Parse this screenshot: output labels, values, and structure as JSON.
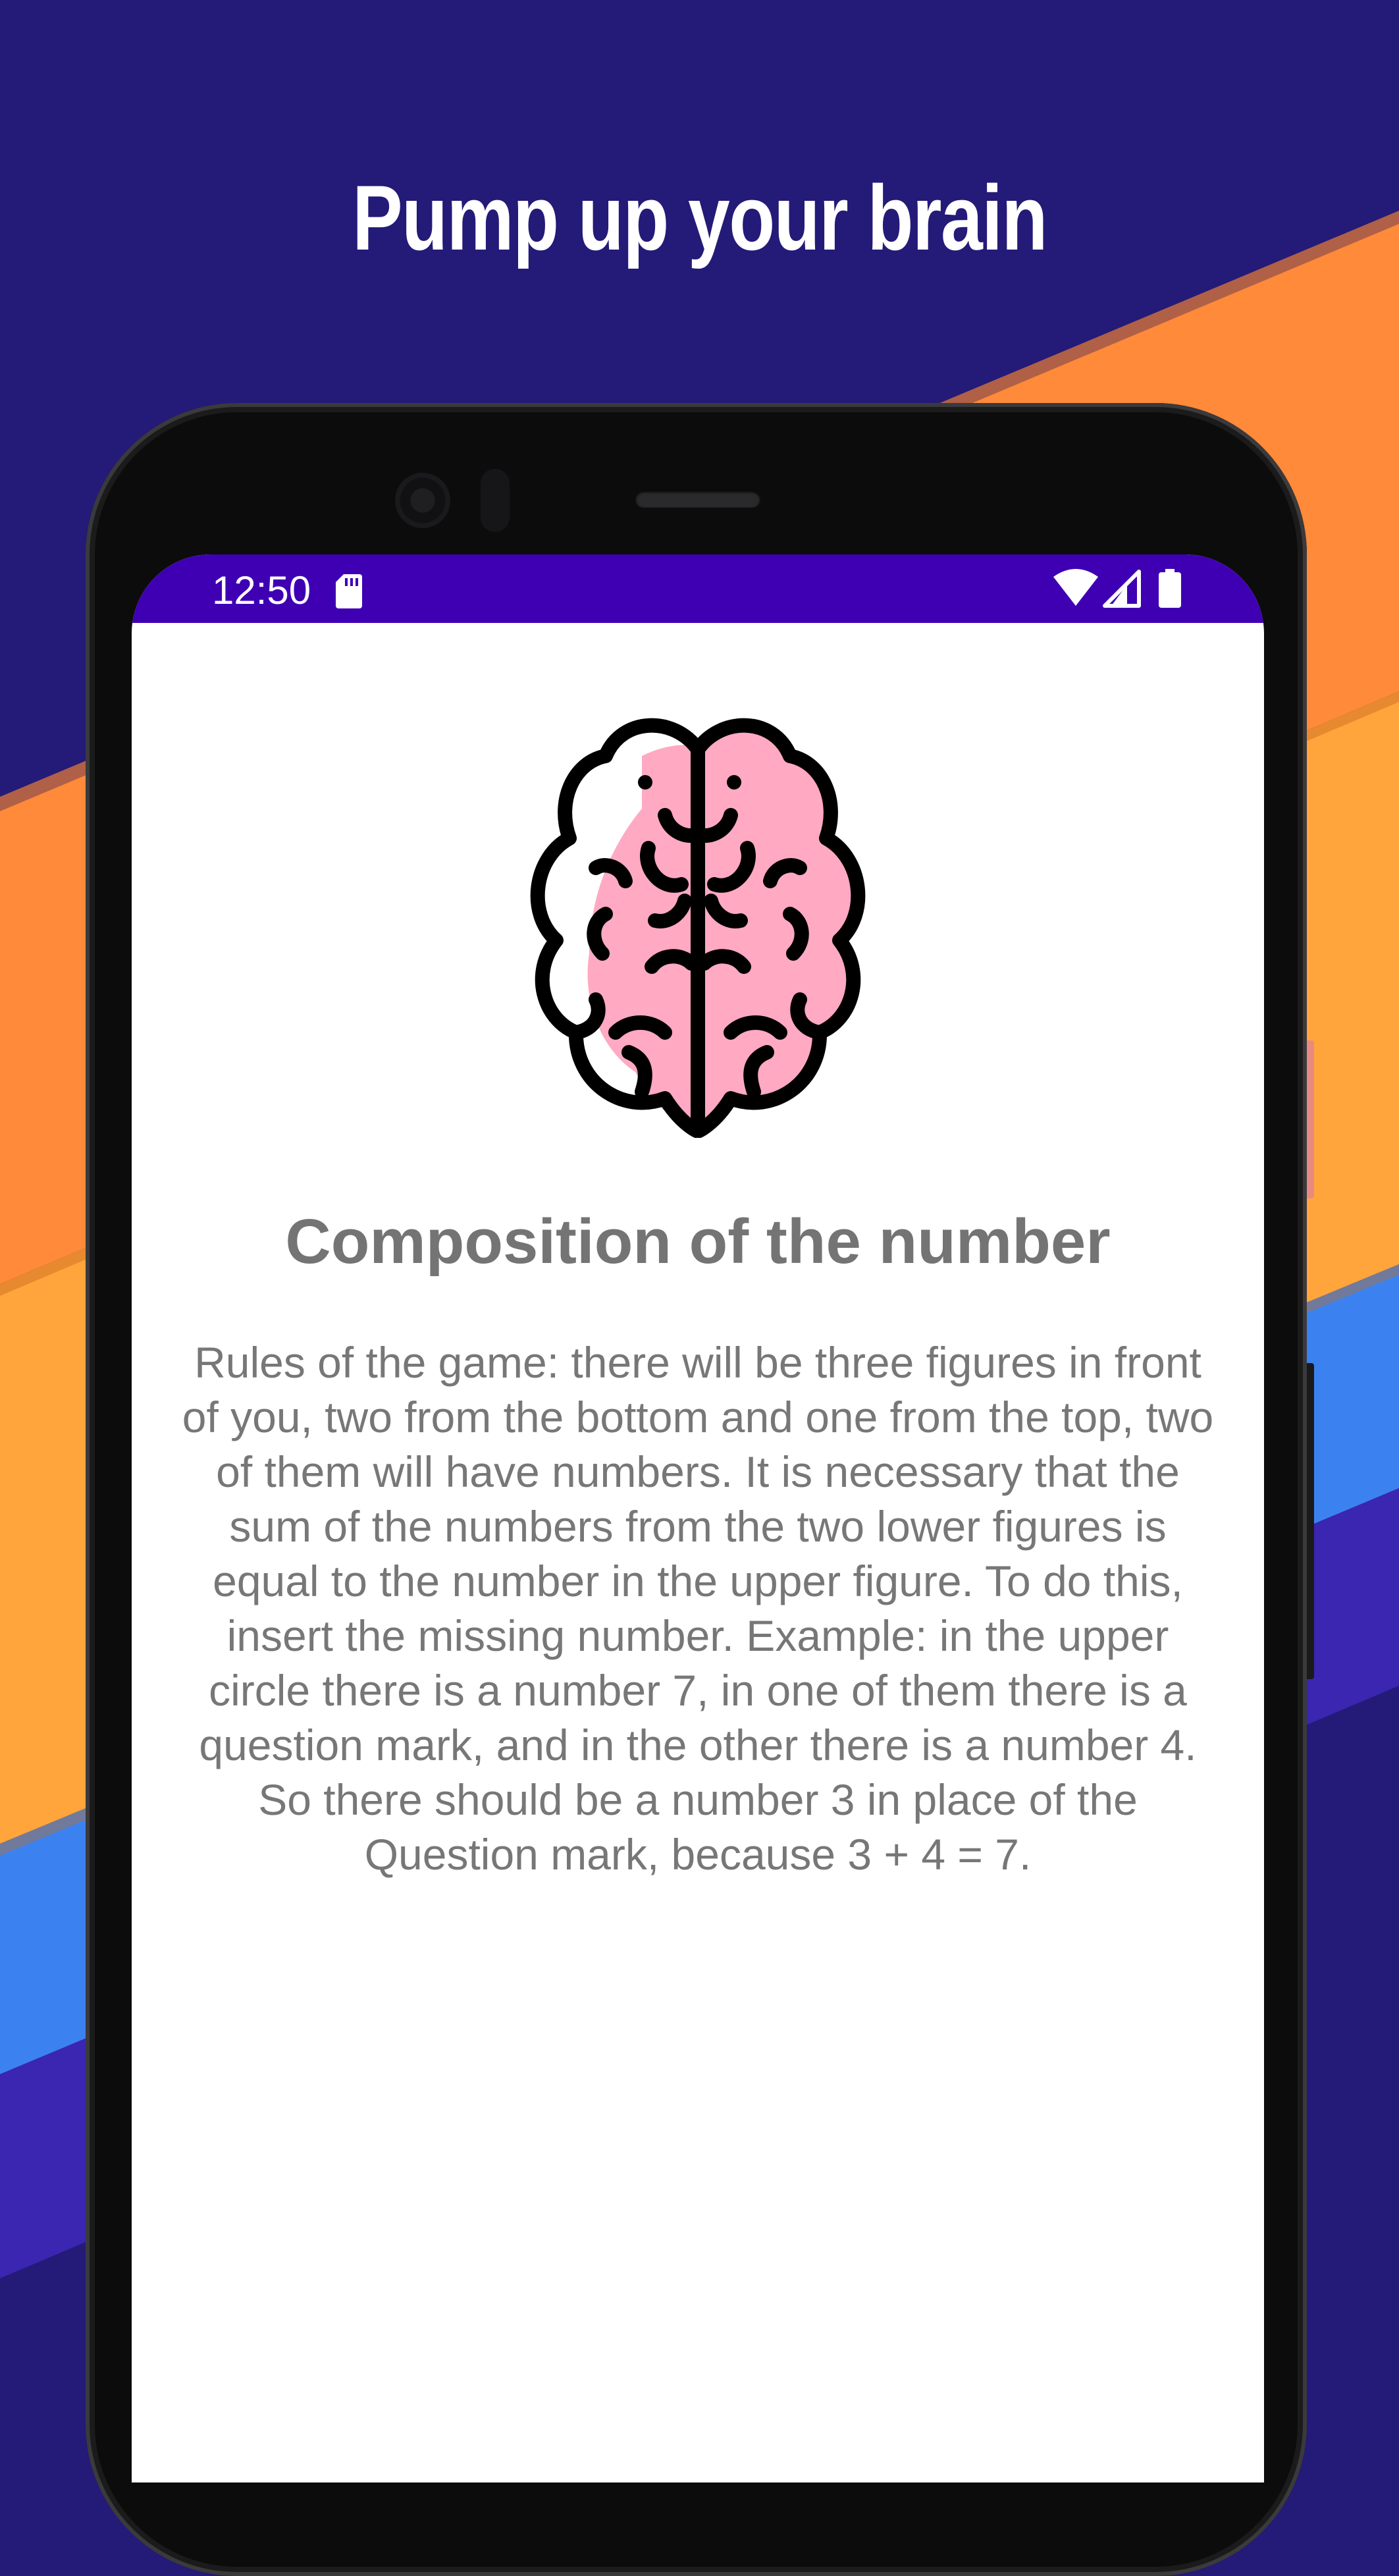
{
  "promo": {
    "headline": "Pump up your brain"
  },
  "status_bar": {
    "time": "12:50",
    "icons": [
      "sd-card-icon",
      "wifi-icon",
      "signal-icon",
      "battery-icon"
    ]
  },
  "screen": {
    "title": "Composition of the number",
    "rules": "Rules of the game: there will be three figures in front of you, two from the bottom and one from the top, two of them will have numbers. It is necessary that the sum of the numbers from the two lower figures is equal to the number in the upper figure. To do this, insert the missing number. Example: in the upper circle there is a number 7, in one of them there is a question mark, and in the other there is a number 4. So there should be a number 3 in place of the Question mark, because 3 + 4 = 7."
  },
  "colors": {
    "background": "#241a78",
    "stripe_orange": "#ff8a3a",
    "stripe_amber": "#ffa53c",
    "stripe_blue": "#3b82f0",
    "stripe_purple": "#3a26b0",
    "status_bar": "#3f00b4",
    "brain_pink": "#ffa9c3",
    "text_gray": "#777777"
  }
}
